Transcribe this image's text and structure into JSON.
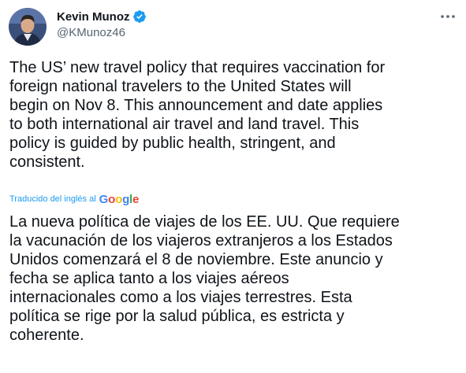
{
  "author": {
    "name": "Kevin Munoz",
    "handle": "@KMunoz46",
    "verified": true,
    "avatar_icon": "profile-photo"
  },
  "icons": {
    "verified": "verified-badge-icon",
    "more": "more-options-icon"
  },
  "tweet": {
    "text": "The US’ new travel policy that requires vaccination for\nforeign national travelers to the United States will\nbegin on Nov 8. This announcement and date applies\nto both international air travel and land travel. This\npolicy is guided by public health, stringent, and\nconsistent."
  },
  "translation": {
    "label": "Traducido del inglés al",
    "provider": "Google",
    "text": "La nueva política de viajes de los EE. UU. Que requiere\nla vacunación de los viajeros extranjeros a los Estados\nUnidos comenzará el 8 de noviembre. Este anuncio y\nfecha se aplica tanto a los viajes aéreos\ninternacionales como a los viajes terrestres. Esta\npolítica se rige por la salud pública, es estricta y\ncoherente."
  },
  "colors": {
    "text_primary": "#0f1419",
    "text_secondary": "#536471",
    "accent": "#1d9bf0",
    "google_blue": "#4285f4",
    "google_red": "#ea4335",
    "google_yellow": "#fbbc05",
    "google_green": "#34a853"
  }
}
